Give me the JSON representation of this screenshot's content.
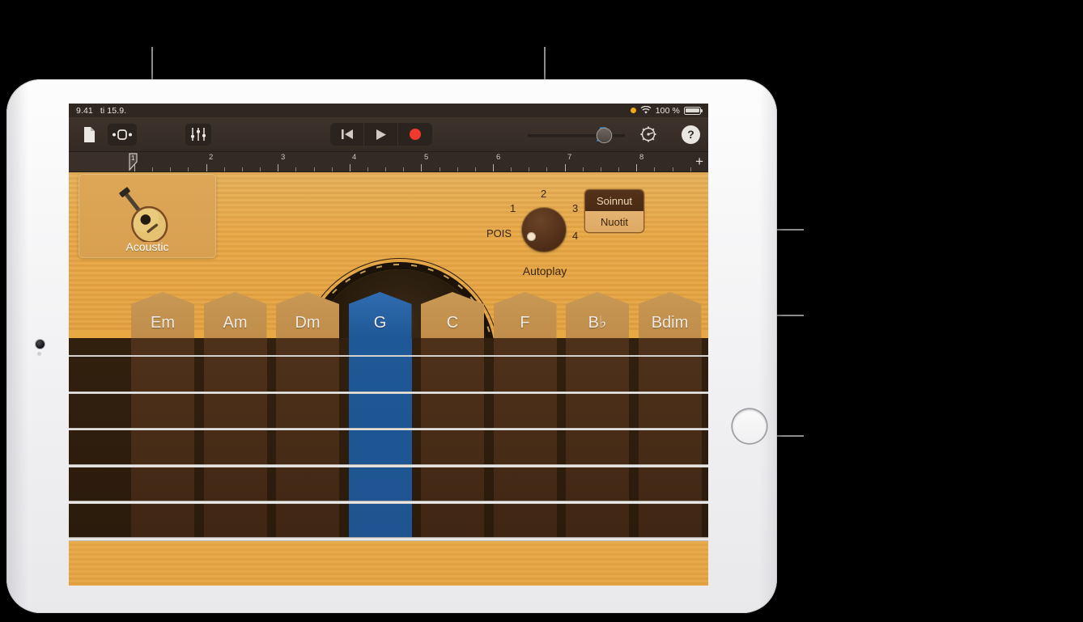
{
  "status_bar": {
    "time": "9.41",
    "date": "ti 15.9.",
    "battery_percent": "100 %",
    "icons": [
      "orange-dot-icon",
      "wifi-icon",
      "battery-icon"
    ]
  },
  "toolbar": {
    "left_buttons": [
      {
        "name": "document-icon",
        "label": ""
      },
      {
        "name": "track-view-icon",
        "label": ""
      },
      {
        "name": "mixer-sliders-icon",
        "label": ""
      }
    ],
    "transport": [
      {
        "name": "rewind-button",
        "label": ""
      },
      {
        "name": "play-button",
        "label": ""
      },
      {
        "name": "record-button",
        "label": ""
      }
    ],
    "volume_value": 72,
    "right_buttons": [
      {
        "name": "metronome-icon",
        "label": ""
      },
      {
        "name": "gear-icon",
        "label": ""
      },
      {
        "name": "help-button",
        "label": "?"
      }
    ],
    "add_label": "+"
  },
  "ruler": {
    "numbers": [
      "1",
      "2",
      "3",
      "4",
      "5",
      "6",
      "7",
      "8"
    ],
    "playhead_position": "1"
  },
  "instrument": {
    "card": {
      "label": "Acoustic",
      "icon": "acoustic-guitar-icon"
    },
    "autoplay": {
      "title": "Autoplay",
      "off_label": "POIS",
      "positions": [
        "1",
        "2",
        "3",
        "4"
      ],
      "selected": "POIS"
    },
    "modes": [
      {
        "label": "Soinnut",
        "selected": true
      },
      {
        "label": "Nuotit",
        "selected": false
      }
    ],
    "chords": [
      {
        "label": "Em",
        "selected": false
      },
      {
        "label": "Am",
        "selected": false
      },
      {
        "label": "Dm",
        "selected": false
      },
      {
        "label": "G",
        "selected": true
      },
      {
        "label": "C",
        "selected": false
      },
      {
        "label": "F",
        "selected": false
      },
      {
        "label": "B♭",
        "selected": false
      },
      {
        "label": "Bdim",
        "selected": false
      }
    ],
    "string_count": 6
  },
  "colors": {
    "accent_blue": "#1f5896",
    "wood_light": "#e8a847",
    "wood_dark": "#2b1b0c",
    "toolbar_dark": "#3d332b",
    "callout_gray": "#8c8c8c",
    "record_red": "#f03a2e",
    "status_orange": "#f0a818"
  },
  "callouts": [
    {
      "name": "callout-instrument-card",
      "target": "Acoustic card"
    },
    {
      "name": "callout-autoplay-knob",
      "target": "Autoplay knob"
    },
    {
      "name": "callout-mode-buttons",
      "target": "Soinnut / Nuotit"
    },
    {
      "name": "callout-chord-strip",
      "target": "Chord strip"
    },
    {
      "name": "callout-strings",
      "target": "Strings"
    }
  ]
}
